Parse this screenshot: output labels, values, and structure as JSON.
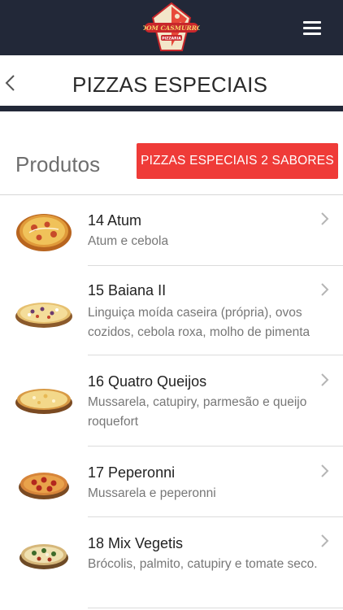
{
  "header": {
    "logo_alt": "Dom Casmurro Pizzaria",
    "logo_text_top": "DOM CASMURRO",
    "logo_text_bottom": "PIZZARIA",
    "menu_icon": "hamburger-menu-icon"
  },
  "titlebar": {
    "back_icon": "chevron-left-icon",
    "title": "PIZZAS ESPECIAIS"
  },
  "section": {
    "label": "Produtos",
    "two_flavor_button": "PIZZAS ESPECIAIS 2 SABORES"
  },
  "products": [
    {
      "name": "14 Atum",
      "description": "Atum e cebola"
    },
    {
      "name": "15 Baiana II",
      "description": "Linguiça moída caseira (própria), ovos cozidos, cebola roxa, molho de pimenta"
    },
    {
      "name": "16 Quatro Queijos",
      "description": "Mussarela, catupiry, parmesão e queijo roquefort"
    },
    {
      "name": "17 Peperonni",
      "description": "Mussarela e peperonni"
    },
    {
      "name": "18 Mix Vegetis",
      "description": "Brócolis, palmito, catupiry e tomate seco."
    }
  ],
  "colors": {
    "navbar": "#222838",
    "accent_button": "#ef3b38"
  }
}
